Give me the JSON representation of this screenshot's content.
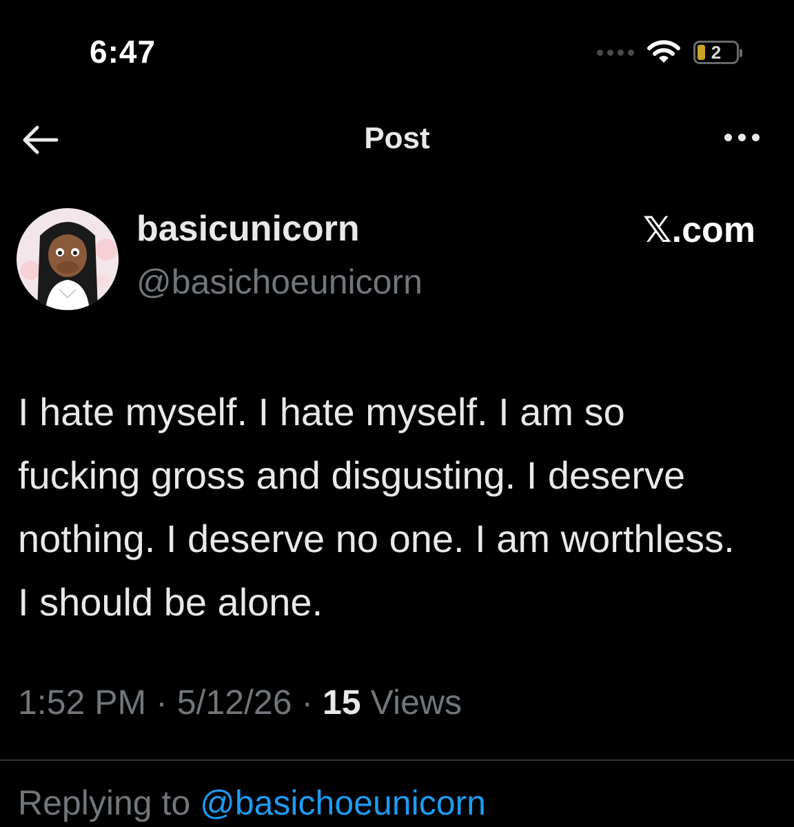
{
  "status_bar": {
    "time": "6:47",
    "battery_level": "2",
    "battery_fraction": 0.2,
    "battery_color": "#c9a227",
    "icons": [
      "signal-dots-icon",
      "wifi-icon",
      "battery-icon"
    ]
  },
  "nav": {
    "title": "Post",
    "back_icon": "arrow-left-icon",
    "more_icon": "more-horizontal-icon"
  },
  "author": {
    "display_name": "basicunicorn",
    "handle": "@basichoeunicorn",
    "avatar_icon": "avatar-image"
  },
  "brand": {
    "label": "𝕏.com"
  },
  "post": {
    "text": "I hate myself. I hate myself. I am so fucking gross and disgusting. I deserve nothing. I deserve no one. I am worthless. I should be alone.",
    "time": "1:52 PM",
    "separator": "·",
    "date": "5/12/26",
    "views_count": "15",
    "views_label": "Views"
  },
  "reply": {
    "prefix": "Replying to",
    "target": "@basichoeunicorn"
  },
  "colors": {
    "background": "#000000",
    "primary_text": "#e7e9ea",
    "secondary_text": "#71767b",
    "accent": "#1d9bf0",
    "divider": "#2f3336"
  }
}
